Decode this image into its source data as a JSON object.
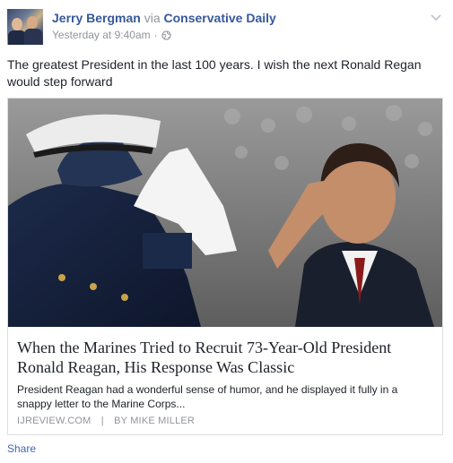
{
  "post": {
    "author_name": "Jerry Bergman",
    "via_text": "via",
    "page_name": "Conservative Daily",
    "timestamp": "Yesterday at 9:40am",
    "separator": "·",
    "message": "The greatest President in the last 100 years. I wish the next Ronald Regan would step forward",
    "icons": {
      "privacy": "globe-icon",
      "options": "chevron-down-icon"
    }
  },
  "link": {
    "title": "When the Marines Tried to Recruit 73-Year-Old President Ronald Reagan, His Response Was Classic",
    "description": "President Reagan had a wonderful sense of humor, and he displayed it fully in a snappy letter to the Marine Corps...",
    "domain": "IJREVIEW.COM",
    "separator": "|",
    "byline": "BY MIKE MILLER"
  },
  "actions": {
    "share_label": "Share"
  },
  "colors": {
    "link_blue": "#365899",
    "meta_gray": "#90949c",
    "action_blue": "#4267b2",
    "border": "#dddfe2"
  }
}
